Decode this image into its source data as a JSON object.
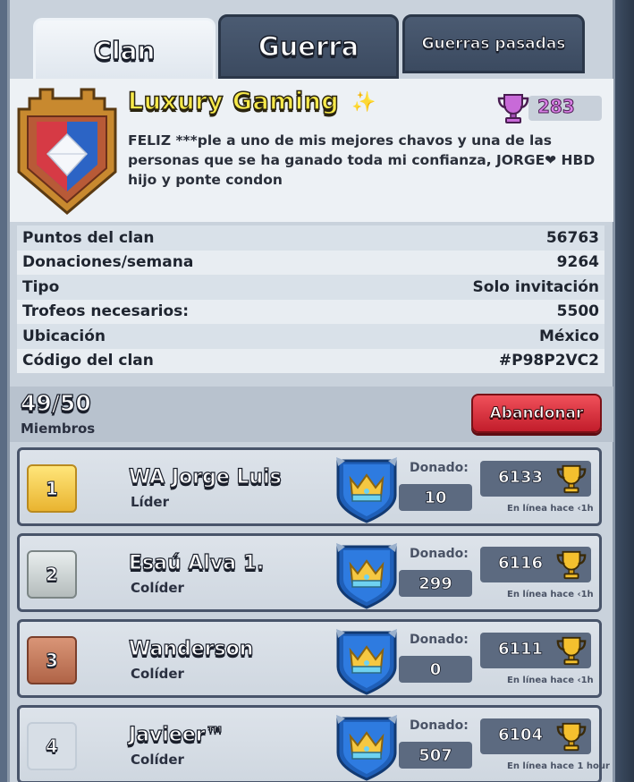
{
  "tabs": {
    "clan": "Clan",
    "war": "Guerra",
    "past_wars": "Guerras pasadas"
  },
  "clan": {
    "name": "Luxury Gaming",
    "trophies": "283",
    "description": "FELIZ ***ple a uno de mis mejores chavos y una de las personas que se ha ganado toda mi confianza, JORGE❤ HBD hijo y ponte condon"
  },
  "stats": [
    {
      "label": "Puntos del clan",
      "value": "56763"
    },
    {
      "label": "Donaciones/semana",
      "value": "9264"
    },
    {
      "label": "Tipo",
      "value": "Solo invitación"
    },
    {
      "label": "Trofeos necesarios:",
      "value": "5500"
    },
    {
      "label": "Ubicación",
      "value": "México"
    },
    {
      "label": "Código del clan",
      "value": "#P98P2VC2"
    }
  ],
  "members_header": {
    "count": "49/50",
    "label": "Miembros",
    "leave_button": "Abandonar"
  },
  "members": [
    {
      "rank": "1",
      "name": "WA Jorge Luis",
      "role": "Líder",
      "donated_label": "Donado:",
      "donated": "10",
      "trophies": "6133",
      "online": "En línea hace ‹1h"
    },
    {
      "rank": "2",
      "name": "Esaú Alva 1.",
      "role": "Colíder",
      "donated_label": "Donado:",
      "donated": "299",
      "trophies": "6116",
      "online": "En línea hace ‹1h"
    },
    {
      "rank": "3",
      "name": "Wanderson",
      "role": "Colíder",
      "donated_label": "Donado:",
      "donated": "0",
      "trophies": "6111",
      "online": "En línea hace ‹1h"
    },
    {
      "rank": "4",
      "name": "Javieer™",
      "role": "Colíder",
      "donated_label": "Donado:",
      "donated": "507",
      "trophies": "6104",
      "online": "En línea hace 1 hour"
    }
  ],
  "colors": {
    "leave_button": "#d9303b",
    "clan_name": "#f7e94a",
    "trophy_purple": "#c86ad8"
  }
}
